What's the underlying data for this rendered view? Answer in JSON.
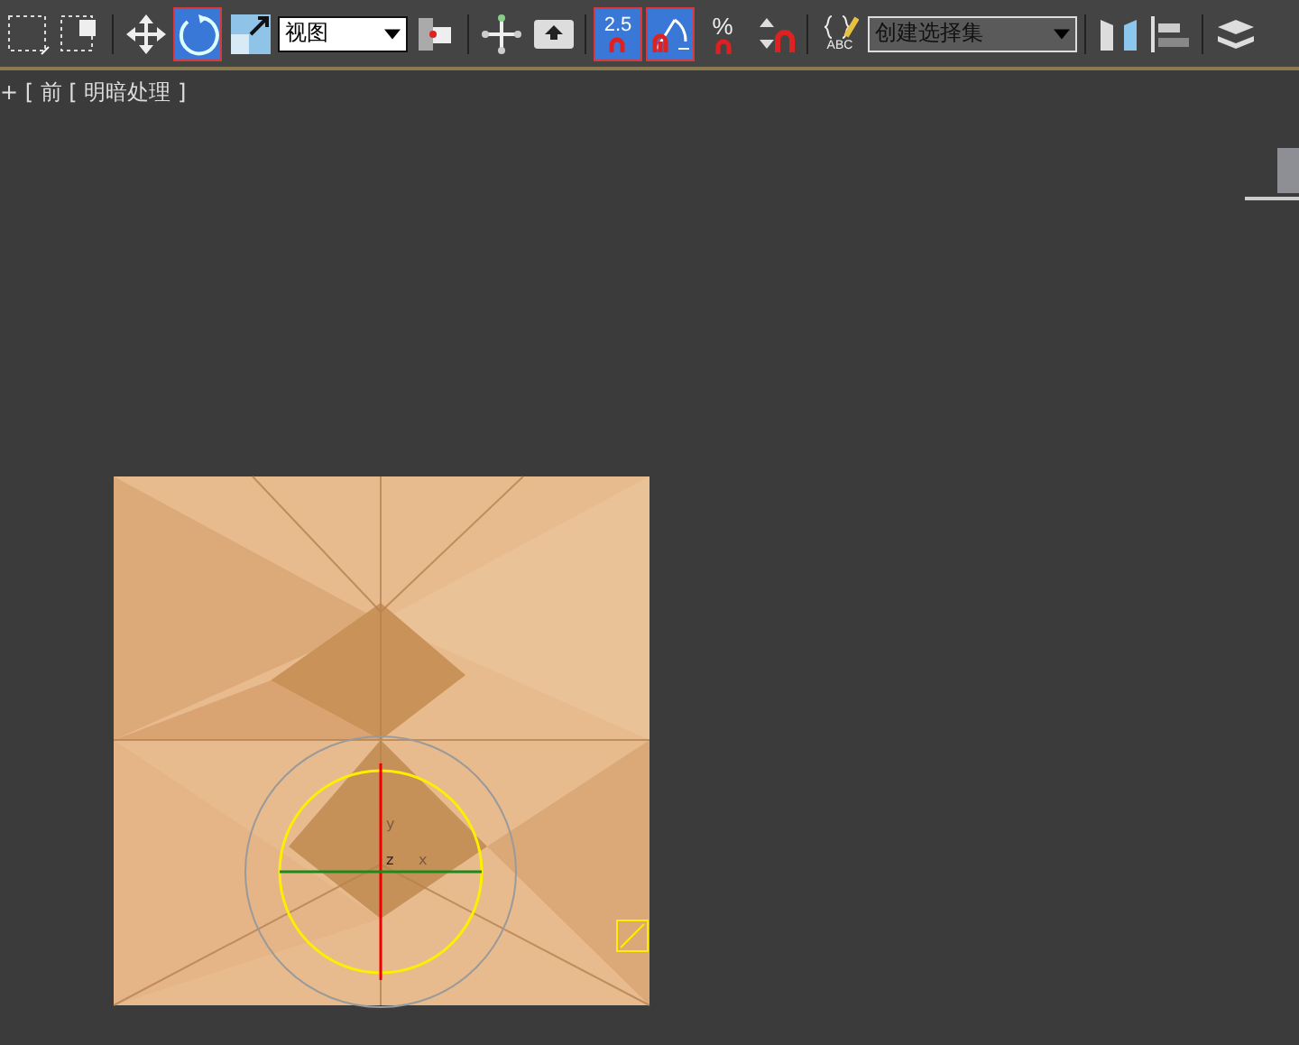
{
  "toolbar": {
    "items": [
      {
        "kind": "button",
        "selected": false
      },
      {
        "kind": "button",
        "selected": false
      },
      {
        "kind": "separator"
      },
      {
        "kind": "button",
        "selected": false
      },
      {
        "kind": "button",
        "selected": true
      },
      {
        "kind": "button",
        "selected": false
      },
      {
        "kind": "dropdown",
        "value": "视图"
      },
      {
        "kind": "button",
        "selected": false
      },
      {
        "kind": "separator"
      },
      {
        "kind": "button",
        "selected": false
      },
      {
        "kind": "button",
        "selected": false
      },
      {
        "kind": "separator"
      },
      {
        "kind": "button",
        "selected": true,
        "label": "2.5"
      },
      {
        "kind": "button",
        "selected": true
      },
      {
        "kind": "button",
        "selected": false,
        "label": "%"
      },
      {
        "kind": "button",
        "selected": false
      },
      {
        "kind": "separator"
      },
      {
        "kind": "button",
        "selected": false,
        "label": "ABC"
      },
      {
        "kind": "dropdown",
        "value": "创建选择集"
      },
      {
        "kind": "separator"
      },
      {
        "kind": "button",
        "selected": false
      },
      {
        "kind": "button",
        "selected": false
      },
      {
        "kind": "separator"
      },
      {
        "kind": "button",
        "selected": false
      }
    ]
  },
  "viewport": {
    "label": "+ [ 前 [ 明暗处理 ]",
    "gizmo": {
      "axes": [
        "y",
        "z",
        "x"
      ]
    }
  }
}
